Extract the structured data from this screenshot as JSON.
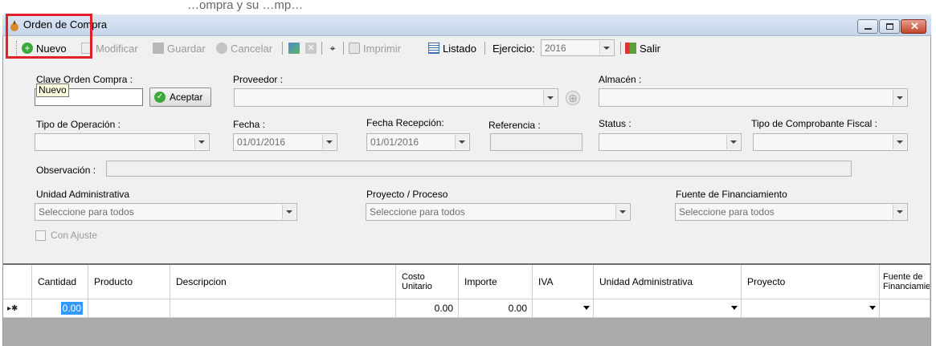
{
  "top_strip": {
    "text": "…ompra y su …mp…"
  },
  "window": {
    "title": "Orden de Compra"
  },
  "toolbar": {
    "nuevo": "Nuevo",
    "modificar": "Modificar",
    "guardar": "Guardar",
    "cancelar": "Cancelar",
    "imprimir": "Imprimir",
    "listado": "Listado",
    "ejercicio_label": "Ejercicio:",
    "ejercicio_value": "2016",
    "salir": "Salir"
  },
  "tooltip": {
    "text": "Nuevo"
  },
  "form": {
    "clave_label": "Clave Orden Compra :",
    "aceptar": "Aceptar",
    "proveedor_label": "Proveedor :",
    "almacen_label": "Almacén :",
    "tipo_operacion_label": "Tipo de Operación :",
    "fecha_label": "Fecha :",
    "fecha_value": "01/01/2016",
    "fecha_recepcion_label": "Fecha Recepción:",
    "fecha_recepcion_value": "01/01/2016",
    "referencia_label": "Referencia :",
    "status_label": "Status :",
    "tipo_comprobante_label": "Tipo de Comprobante Fiscal :",
    "observacion_label": "Observación :",
    "unidad_label": "Unidad Administrativa",
    "unidad_value": "Seleccione para todos",
    "proyecto_label": "Proyecto / Proceso",
    "proyecto_value": "Seleccione para todos",
    "fuente_label": "Fuente de Financiamiento",
    "fuente_value": "Seleccione para todos",
    "con_ajuste": "Con Ajuste"
  },
  "grid": {
    "columns": [
      "Cantidad",
      "Producto",
      "Descripcion",
      "Costo Unitario",
      "Importe",
      "IVA",
      "Unidad Administrativa",
      "Proyecto",
      "Fuente de Financiamie"
    ],
    "new_row_marker": "▸✱",
    "row": {
      "cantidad": "0.00",
      "costo": "0.00",
      "importe": "0.00"
    }
  },
  "colors": {
    "highlight": "#e0202a",
    "selection": "#3399ff",
    "grid_bg": "#ababab"
  }
}
